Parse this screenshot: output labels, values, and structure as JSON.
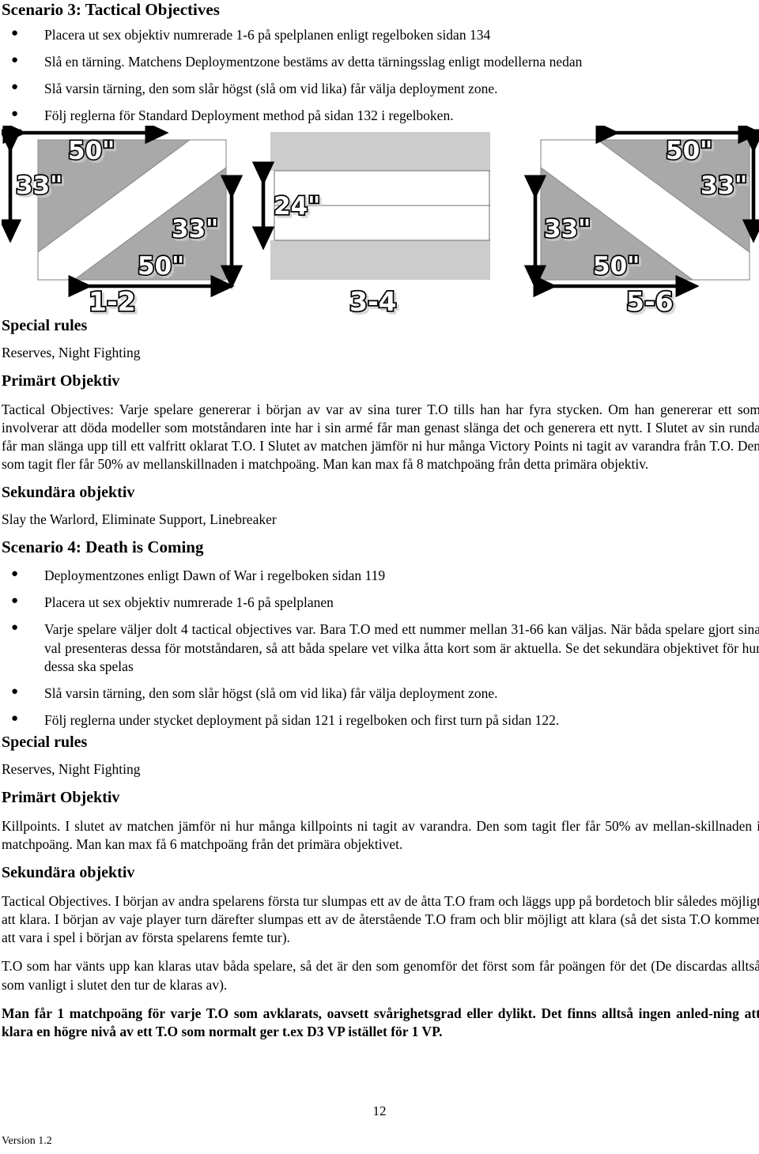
{
  "scenario3": {
    "heading": "Scenario 3:  Tactical Objectives",
    "bullets": [
      "Placera ut sex objektiv numrerade 1-6 på spelplanen enligt regelboken sidan 134",
      "Slå en tärning. Matchens Deploymentzone bestäms av detta tärningsslag enligt modellerna nedan",
      "Slå varsin tärning, den som slår  högst (slå om vid lika) får välja deployment zone.",
      "Följ reglerna för Standard Deployment method på sidan 132 i regelboken."
    ],
    "special_rules_heading": "Special rules",
    "special_rules_text": "Reserves, Night Fighting",
    "primary_heading": "Primärt Objektiv",
    "primary_text": "Tactical Objectives: Varje spelare genererar i början av var av sina turer T.O tills han har fyra stycken. Om han genererar ett som involverar att döda modeller som motståndaren inte har i sin armé får man genast slänga det och generera ett nytt. I Slutet av sin runda får man slänga upp till ett valfritt oklarat T.O. I Slutet av matchen jämför ni hur många Victory Points ni tagit av varandra från T.O. Den som tagit fler får 50% av mellanskillnaden i matchpoäng. Man kan max få 8 matchpoäng från detta primära objektiv.",
    "secondary_heading": "Sekundära objektiv",
    "secondary_text": "Slay the Warlord, Eliminate Support, Linebreaker"
  },
  "deployment_diagrams": {
    "zones": [
      {
        "label": "1-2",
        "type": "diagonal-descending",
        "dimensions": {
          "top_width": "50\"",
          "left_height": "33\"",
          "right_height": "33\"",
          "bottom_width": "50\""
        }
      },
      {
        "label": "3-4",
        "type": "horizontal-bands",
        "dimensions": {
          "center_gap": "24\""
        }
      },
      {
        "label": "5-6",
        "type": "diagonal-ascending",
        "dimensions": {
          "top_width": "50\"",
          "right_height": "33\"",
          "left_height": "33\"",
          "bottom_width": "50\""
        }
      }
    ],
    "colors": {
      "zone_fill": "#a9a9a9",
      "band_fill": "#cccccc",
      "outline": "#7a7a7a",
      "arrow": "#000000"
    }
  },
  "scenario4": {
    "heading": "Scenario 4: Death is Coming",
    "bullets": [
      "Deploymentzones enligt Dawn of War i regelboken sidan 119",
      "Placera ut sex objektiv numrerade 1-6 på spelplanen",
      "Varje spelare väljer dolt 4 tactical objectives var. Bara T.O med ett nummer mellan 31-66 kan väljas. När båda spelare gjort sina val presenteras dessa för motståndaren, så att båda spelare vet vilka åtta kort som är aktuella. Se det sekundära objektivet för hur dessa ska spelas",
      "Slå varsin tärning, den som slår  högst (slå om vid lika) får välja deployment zone.",
      "Följ reglerna under stycket deployment på sidan 121 i regelboken och first turn på sidan 122."
    ],
    "special_rules_heading": "Special rules",
    "special_rules_text": "Reserves, Night Fighting",
    "primary_heading": "Primärt Objektiv",
    "primary_text": "Killpoints. I slutet av matchen jämför ni hur många killpoints ni tagit av varandra. Den som tagit fler får 50% av mellan-skillnaden i matchpoäng. Man kan max få 6 matchpoäng från det primära objektivet.",
    "secondary_heading": "Sekundära objektiv",
    "secondary_para1": "Tactical Objectives. I början av andra spelarens första tur slumpas ett av de åtta T.O fram och läggs upp på bordetoch blir således möjligt att klara. I början av vaje player turn därefter slumpas ett av de återstående T.O fram och blir möjligt att klara (så det sista T.O kommer att vara i spel i början av första spelarens femte tur).",
    "secondary_para2": "T.O som har vänts upp kan klaras utav båda spelare, så det är den som genomför det först som får poängen för det (De discardas alltså som vanligt i slutet den tur de klaras av).",
    "secondary_para3": "Man får 1 matchpoäng för varje T.O som avklarats, oavsett svårighetsgrad eller dylikt. Det finns alltså ingen anled-ning att klara en högre nivå av ett T.O som normalt ger t.ex D3 VP istället för 1 VP."
  },
  "footer": {
    "page_number": "12",
    "version": "Version 1.2"
  }
}
